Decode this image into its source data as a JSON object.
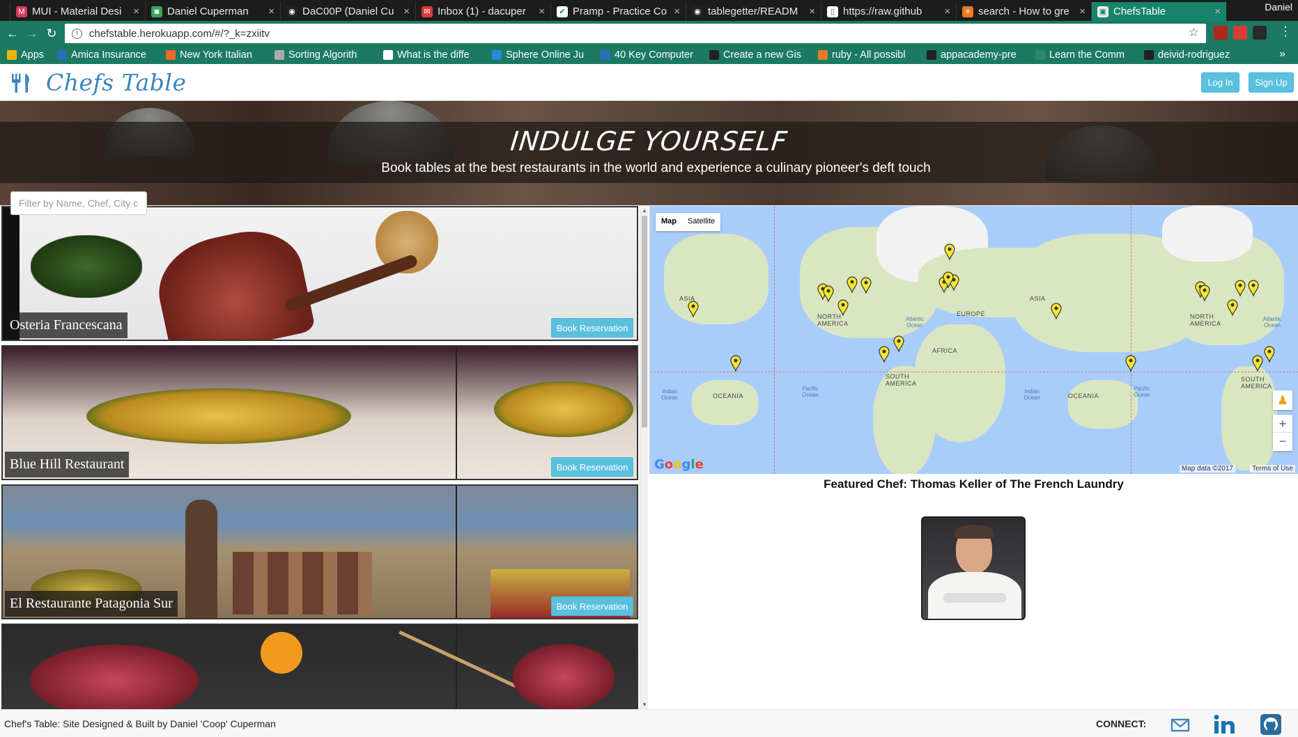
{
  "browser": {
    "tabs": [
      {
        "title": "MUI - Material Desi",
        "icon": "m-icon",
        "color": "#d93a5a",
        "glyph": "M"
      },
      {
        "title": "Daniel Cuperman",
        "icon": "profile-icon",
        "color": "#3aa55a",
        "glyph": "◙"
      },
      {
        "title": "DaC00P (Daniel Cu",
        "icon": "github-icon",
        "color": "#222222",
        "glyph": "◉"
      },
      {
        "title": "Inbox (1) - dacuper",
        "icon": "gmail-icon",
        "color": "#d93a3a",
        "glyph": "✉"
      },
      {
        "title": "Pramp - Practice Co",
        "icon": "pramp-icon",
        "color": "#ffffff",
        "glyph": "✔"
      },
      {
        "title": "tablegetter/READM",
        "icon": "github-icon",
        "color": "#222222",
        "glyph": "◉"
      },
      {
        "title": "https://raw.github",
        "icon": "file-icon",
        "color": "#ffffff",
        "glyph": "▯"
      },
      {
        "title": "search - How to gre",
        "icon": "stackoverflow-icon",
        "color": "#e87b22",
        "glyph": "≡"
      },
      {
        "title": "ChefsTable",
        "icon": "chefstable-icon",
        "color": "#eeeeee",
        "glyph": "▣"
      }
    ],
    "profile_name": "Daniel",
    "url": "chefstable.herokuapp.com/#/?_k=zxiitv",
    "bookmarks": [
      {
        "label": "Apps",
        "color": "#f4b400"
      },
      {
        "label": "Amica Insurance",
        "color": "#2a6ebb"
      },
      {
        "label": "New York Italian",
        "color": "#e86a2a"
      },
      {
        "label": "Sorting Algorith",
        "color": "#aaaaaa"
      },
      {
        "label": "What is the diffe",
        "color": "#ffffff"
      },
      {
        "label": "Sphere Online Ju",
        "color": "#2a8ad6"
      },
      {
        "label": "40 Key Computer",
        "color": "#2a6ebb"
      },
      {
        "label": "Create a new Gis",
        "color": "#222222"
      },
      {
        "label": "ruby - All possibl",
        "color": "#e87b22"
      },
      {
        "label": "appacademy-pre",
        "color": "#222222"
      },
      {
        "label": "Learn the Comm",
        "color": "#2a8a6a"
      },
      {
        "label": "deivid-rodriguez",
        "color": "#222222"
      }
    ]
  },
  "nav": {
    "logo_text": "Chefs Table",
    "login_label": "Log In",
    "signup_label": "Sign Up"
  },
  "hero": {
    "title": "INDULGE YOURSELF",
    "subtitle": "Book tables at the best restaurants in the world and experience a culinary pioneer's deft touch"
  },
  "filter": {
    "placeholder": "Filter by Name, Chef, City c"
  },
  "restaurants": [
    {
      "name": "Osteria Francescana",
      "book_label": "Book Reservation"
    },
    {
      "name": "Blue Hill Restaurant",
      "book_label": "Book Reservation"
    },
    {
      "name": "El Restaurante Patagonia Sur",
      "book_label": "Book Reservation"
    },
    {
      "name": "",
      "book_label": ""
    }
  ],
  "map": {
    "map_label": "Map",
    "satellite_label": "Satellite",
    "labels": [
      "ASIA",
      "NORTH AMERICA",
      "EUROPE",
      "ASIA",
      "AFRICA",
      "NORTH AMERICA",
      "SOUTH AMERICA",
      "SOUTH AMERICA",
      "OCEANIA",
      "OCEANIA"
    ],
    "oceans": [
      "Atlantic Ocean",
      "Indian Ocean",
      "Pacific Ocean",
      "Indian Ocean",
      "Pacific Ocean",
      "Atlantic Ocean"
    ],
    "attribution": "Map data ©2017",
    "terms": "Terms of Use",
    "google": "Google"
  },
  "featured": {
    "text": "Featured Chef: Thomas Keller of The French Laundry"
  },
  "footer": {
    "credit": "Chef's Table: Site Designed & Built by Daniel 'Coop' Cuperman",
    "connect": "CONNECT:"
  }
}
